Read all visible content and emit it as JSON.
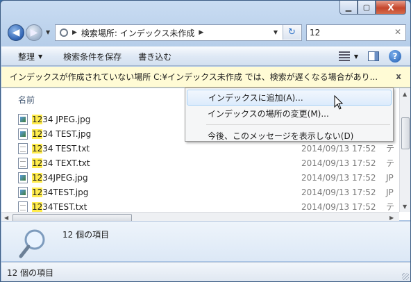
{
  "window": {
    "min_label": "▁",
    "max_label": "▢",
    "close_label": "X"
  },
  "nav": {
    "back_label": "◀",
    "forward_label": "▶",
    "address_parts": [
      "検索場所: インデックス未作成"
    ],
    "search_value": "12",
    "search_clear": "✕"
  },
  "toolbar": {
    "organize": "整理",
    "save_search": "検索条件を保存",
    "burn": "書き込む"
  },
  "infobar": {
    "text": "インデックスが作成されていない場所 C:¥インデックス未作成 では、検索が遅くなる場合があり...",
    "close": "x"
  },
  "list": {
    "column_name": "名前",
    "files": [
      {
        "hl": "12",
        "rest": "34 JPEG.jpg",
        "icon": "image-file-icon",
        "date": "",
        "type": ""
      },
      {
        "hl": "12",
        "rest": "34 TEST.jpg",
        "icon": "image-file-icon",
        "date": "",
        "type": ""
      },
      {
        "hl": "12",
        "rest": "34 TEST.txt",
        "icon": "text-file-icon",
        "date": "2014/09/13 17:52",
        "type": "テ"
      },
      {
        "hl": "12",
        "rest": "34 TEXT.txt",
        "icon": "text-file-icon",
        "date": "2014/09/13 17:52",
        "type": "テ"
      },
      {
        "hl": "12",
        "rest": "34JPEG.jpg",
        "icon": "image-file-icon",
        "date": "2014/09/13 17:52",
        "type": "JP"
      },
      {
        "hl": "12",
        "rest": "34TEST.jpg",
        "icon": "image-file-icon",
        "date": "2014/09/13 17:52",
        "type": "JP"
      },
      {
        "hl": "12",
        "rest": "34TEST.txt",
        "icon": "text-file-icon",
        "date": "2014/09/13 17:52",
        "type": "テ"
      }
    ]
  },
  "details": {
    "count_text": "12 個の項目"
  },
  "status": {
    "text": "12 個の項目"
  },
  "context_menu": {
    "items": [
      "インデックスに追加(A)...",
      "インデックスの場所の変更(M)...",
      "今後、このメッセージを表示しない(D)"
    ]
  }
}
